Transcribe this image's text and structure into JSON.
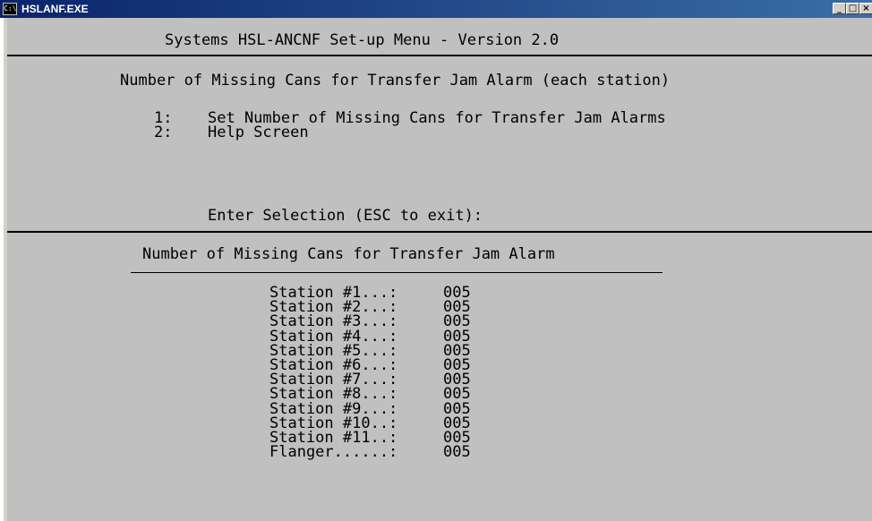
{
  "window": {
    "title": "HSLANF.EXE",
    "icon": "console-icon"
  },
  "header": {
    "title": "Systems HSL-ANCNF Set-up Menu - Version 2.0"
  },
  "menu": {
    "title": "Number of Missing Cans for Transfer Jam Alarm (each station)",
    "options": [
      {
        "num": "1:",
        "label": "Set Number of Missing Cans for Transfer Jam Alarms"
      },
      {
        "num": "2:",
        "label": "Help Screen"
      }
    ],
    "prompt": "Enter Selection (ESC to exit):"
  },
  "status": {
    "title": "Number of Missing Cans for Transfer Jam Alarm",
    "rows": [
      {
        "label": "Station #1...:",
        "value": "005"
      },
      {
        "label": "Station #2...:",
        "value": "005"
      },
      {
        "label": "Station #3...:",
        "value": "005"
      },
      {
        "label": "Station #4...:",
        "value": "005"
      },
      {
        "label": "Station #5...:",
        "value": "005"
      },
      {
        "label": "Station #6...:",
        "value": "005"
      },
      {
        "label": "Station #7...:",
        "value": "005"
      },
      {
        "label": "Station #8...:",
        "value": "005"
      },
      {
        "label": "Station #9...:",
        "value": "005"
      },
      {
        "label": "Station #10..:",
        "value": "005"
      },
      {
        "label": "Station #11..:",
        "value": "005"
      },
      {
        "label": "Flanger......:",
        "value": "005"
      }
    ]
  },
  "colors": {
    "console_bg": "#c0c0c0",
    "text": "#000000",
    "titlebar": "#0a246a"
  }
}
